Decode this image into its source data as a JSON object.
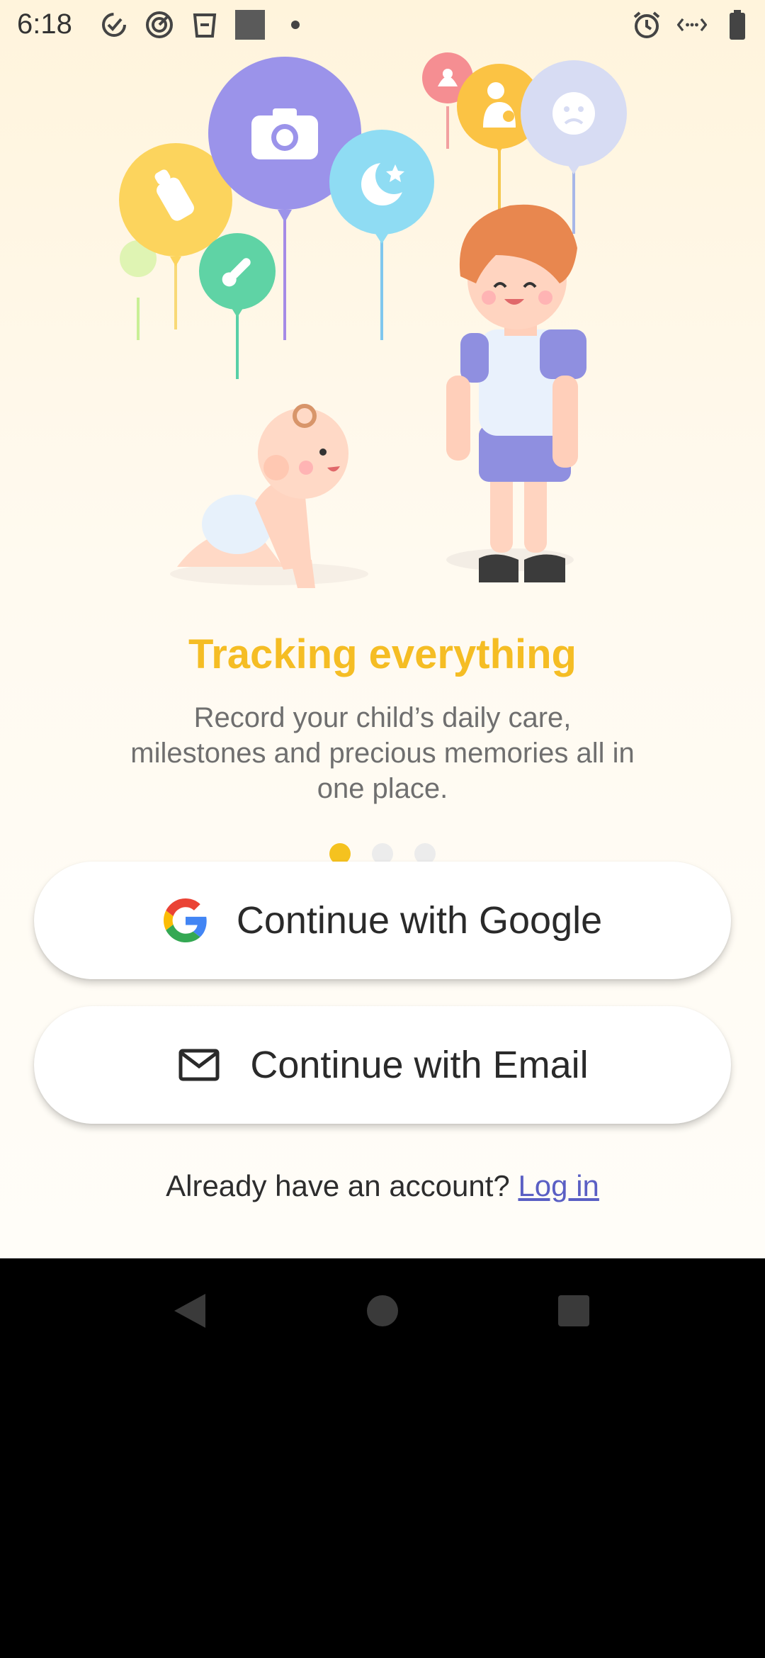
{
  "status_bar": {
    "time": "6:18",
    "left_icons": [
      "check-badge-icon",
      "target-check-icon",
      "trash-can-icon",
      "square-thumbnail-icon",
      "dot-icon"
    ],
    "right_icons": [
      "alarm-icon",
      "data-saver-icon",
      "battery-icon"
    ]
  },
  "illustration": {
    "balloons": [
      "bottle-icon",
      "camera-icon",
      "moon-star-icon",
      "thermometer-icon",
      "poop-icon",
      "breastfeeding-icon",
      "sad-face-icon"
    ]
  },
  "onboarding": {
    "title": "Tracking everything",
    "description": "Record your child’s daily care, milestones and precious memories all in one place.",
    "page_count": 3,
    "active_page": 1
  },
  "auth": {
    "google_label": "Continue with Google",
    "email_label": "Continue with Email",
    "login_prompt": "Already have an account?",
    "login_link": "Log in"
  },
  "colors": {
    "accent": "#f5bd24",
    "link": "#5a5fc4",
    "background": "#fff7e6"
  }
}
